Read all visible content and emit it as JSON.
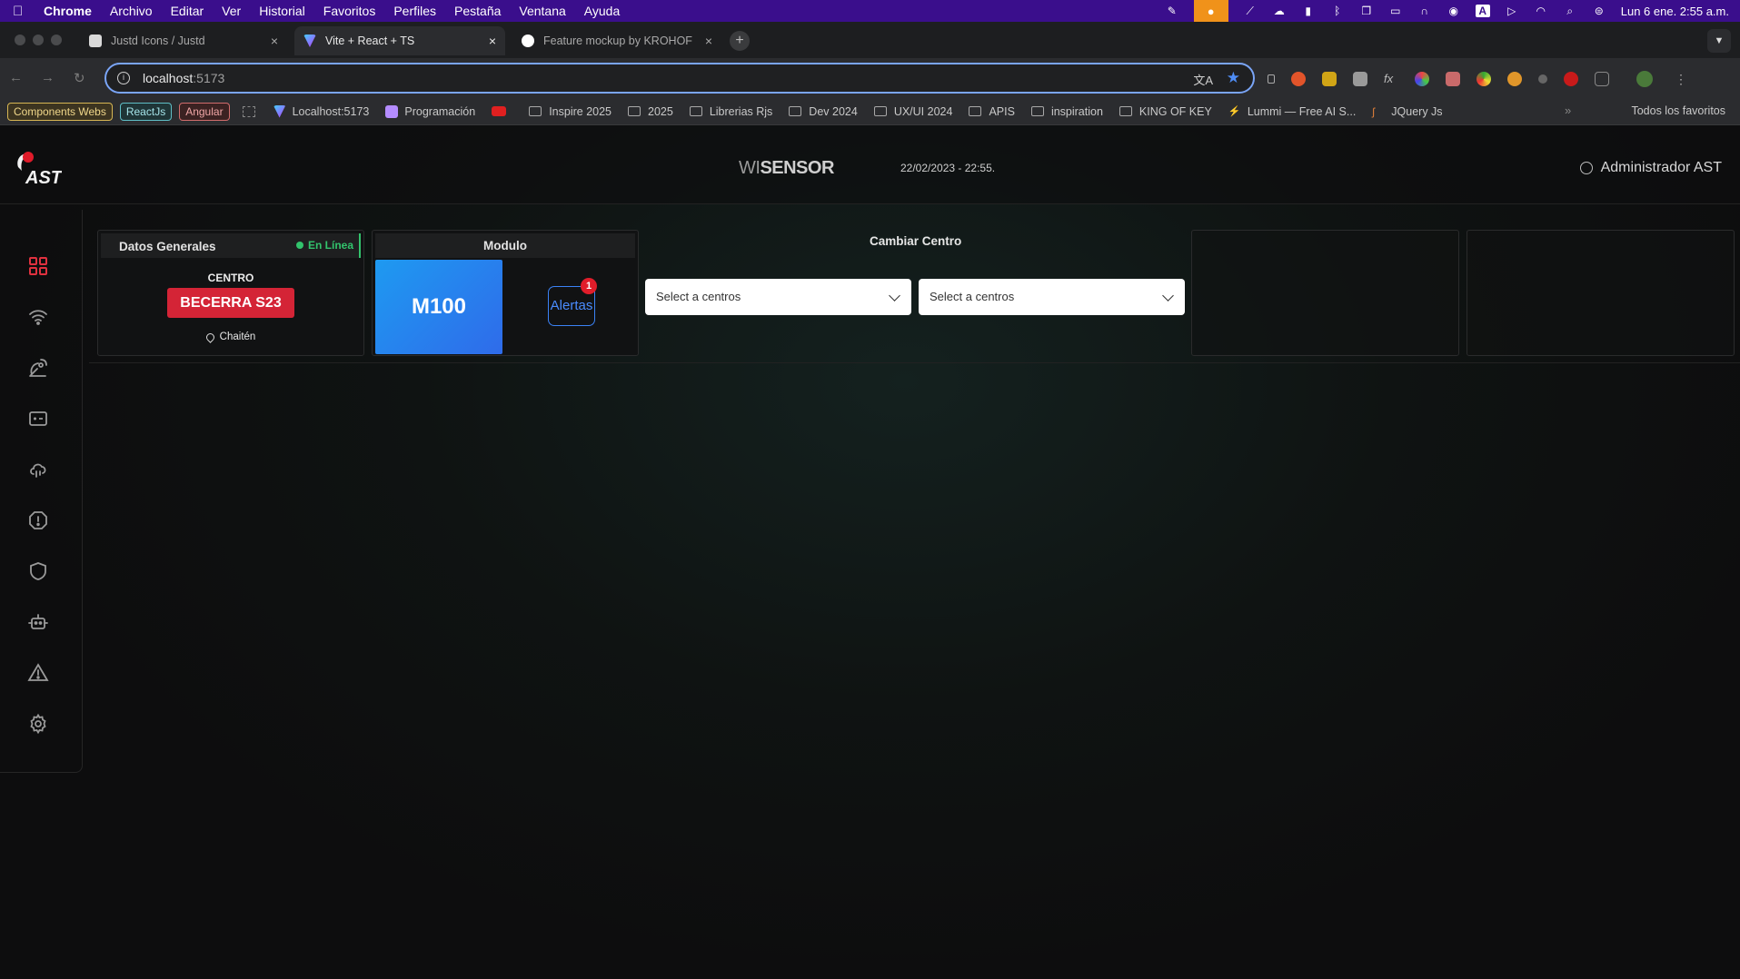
{
  "menubar": {
    "apple": "",
    "items": [
      "Chrome",
      "Archivo",
      "Editar",
      "Ver",
      "Historial",
      "Favoritos",
      "Perfiles",
      "Pestaña",
      "Ventana",
      "Ayuda"
    ],
    "clock": "Lun 6 ene.  2:55 a.m."
  },
  "tabs": [
    {
      "title": "Justd Icons / Justd",
      "icon_color": "#d9d9d9"
    },
    {
      "title": "Vite + React + TS",
      "icon_color": "#8e6bf5"
    },
    {
      "title": "Feature mockup by KROHOFF",
      "icon_color": "#ffffff"
    }
  ],
  "address": {
    "host": "localhost",
    "port": ":5173"
  },
  "bookmarks": {
    "pills": [
      "Components Webs",
      "ReactJs",
      "Angular"
    ],
    "items": [
      {
        "label": "Localhost:5173",
        "kind": "favicon",
        "color": "#8e6bf5"
      },
      {
        "label": "Programación",
        "kind": "favicon",
        "color": "#b48cff"
      },
      {
        "label": "",
        "kind": "favicon",
        "color": "#e02020"
      },
      {
        "label": "Inspire 2025",
        "kind": "folder"
      },
      {
        "label": "2025",
        "kind": "folder"
      },
      {
        "label": "Librerias Rjs",
        "kind": "folder"
      },
      {
        "label": "Dev 2024",
        "kind": "folder"
      },
      {
        "label": "UX/UI 2024",
        "kind": "folder"
      },
      {
        "label": "APIS",
        "kind": "folder"
      },
      {
        "label": "inspiration",
        "kind": "folder"
      },
      {
        "label": "KING OF KEY",
        "kind": "folder"
      },
      {
        "label": "Lummi — Free AI S...",
        "kind": "favicon",
        "color": "#c9c9c9"
      },
      {
        "label": "JQuery Js",
        "kind": "favicon",
        "color": "#e0803a"
      }
    ],
    "all_favorites": "Todos los favoritos"
  },
  "app": {
    "logo_text": "AST",
    "brand_prefix": "WI",
    "brand_main": "SENSOR",
    "datetime": "22/02/2023 - 22:55.",
    "user": "Administrador AST",
    "general": {
      "title": "Datos Generales",
      "status": "En Línea",
      "centro_label": "CENTRO",
      "centro_name": "BECERRA S23",
      "location": "Chaitén"
    },
    "module": {
      "title": "Modulo",
      "name": "M100",
      "alert_label": "Alertas",
      "alert_count": "1"
    },
    "cambiar": {
      "title": "Cambiar Centro",
      "select1_placeholder": "Select a centros",
      "select2_placeholder": "Select a centros"
    },
    "sidebar_icons": [
      "dashboard-icon",
      "wifi-icon",
      "satellite-icon",
      "monitor-icon",
      "cloud-icon",
      "alert-octagon-icon",
      "shield-icon",
      "robot-icon",
      "warning-triangle-icon",
      "settings-icon"
    ],
    "accent": "#d42436"
  }
}
